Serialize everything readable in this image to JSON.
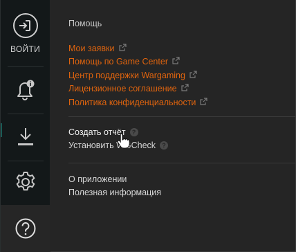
{
  "sidebar": {
    "login_label": "ВОЙТИ",
    "icons": [
      "login-icon",
      "notification-bell-icon",
      "download-icon",
      "gear-icon",
      "help-icon"
    ],
    "accent": "#1a5b56"
  },
  "help": {
    "title": "Помощь",
    "links": [
      {
        "label": "Мои заявки"
      },
      {
        "label": "Помощь по Game Center"
      },
      {
        "label": "Центр поддержки Wargaming"
      },
      {
        "label": "Лицензионное соглашение"
      },
      {
        "label": "Политика конфиденциальности"
      }
    ],
    "link_color": "#e0640e"
  },
  "tools": {
    "create_report": "Создать отчёт",
    "install_wgcheck": "Установить WGCheck"
  },
  "about": {
    "about_app": "О приложении",
    "useful_info": "Полезная информация"
  }
}
